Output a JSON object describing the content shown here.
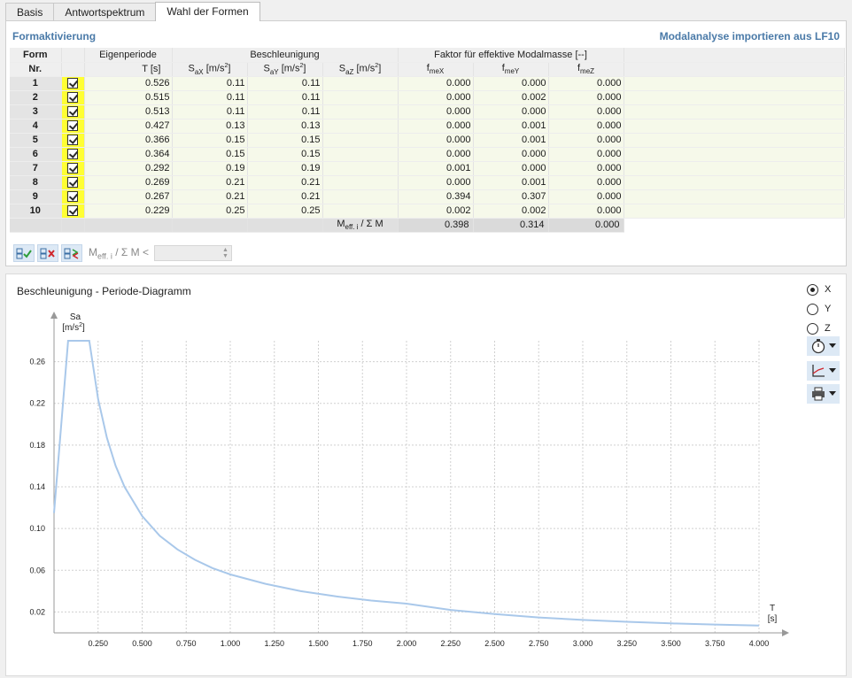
{
  "tabs": [
    {
      "label": "Basis",
      "active": false
    },
    {
      "label": "Antwortspektrum",
      "active": false
    },
    {
      "label": "Wahl der Formen",
      "active": true
    }
  ],
  "section": {
    "title": "Formaktivierung",
    "import_link": "Modalanalyse importieren aus LF10"
  },
  "table": {
    "headers": {
      "form": "Form",
      "nr": "Nr.",
      "eigenperiode": "Eigenperiode",
      "period_unit": "T [s]",
      "beschleunigung": "Beschleunigung",
      "sax": "S",
      "sax_sub": "aX",
      "sa_unit": " [m/s",
      "sup2": "2",
      "close": "]",
      "say_sub": "aY",
      "saz_sub": "aZ",
      "faktor": "Faktor für effektive Modalmasse [--]",
      "f": "f",
      "fmex_sub": "meX",
      "fmey_sub": "meY",
      "fmez_sub": "meZ"
    },
    "rows": [
      {
        "nr": "1",
        "checked": true,
        "t": "0.526",
        "sax": "0.11",
        "say": "0.11",
        "saz": "",
        "fmex": "0.000",
        "fmey": "0.000",
        "fmez": "0.000"
      },
      {
        "nr": "2",
        "checked": true,
        "t": "0.515",
        "sax": "0.11",
        "say": "0.11",
        "saz": "",
        "fmex": "0.000",
        "fmey": "0.002",
        "fmez": "0.000"
      },
      {
        "nr": "3",
        "checked": true,
        "t": "0.513",
        "sax": "0.11",
        "say": "0.11",
        "saz": "",
        "fmex": "0.000",
        "fmey": "0.000",
        "fmez": "0.000"
      },
      {
        "nr": "4",
        "checked": true,
        "t": "0.427",
        "sax": "0.13",
        "say": "0.13",
        "saz": "",
        "fmex": "0.000",
        "fmey": "0.001",
        "fmez": "0.000"
      },
      {
        "nr": "5",
        "checked": true,
        "t": "0.366",
        "sax": "0.15",
        "say": "0.15",
        "saz": "",
        "fmex": "0.000",
        "fmey": "0.001",
        "fmez": "0.000"
      },
      {
        "nr": "6",
        "checked": true,
        "t": "0.364",
        "sax": "0.15",
        "say": "0.15",
        "saz": "",
        "fmex": "0.000",
        "fmey": "0.000",
        "fmez": "0.000"
      },
      {
        "nr": "7",
        "checked": true,
        "t": "0.292",
        "sax": "0.19",
        "say": "0.19",
        "saz": "",
        "fmex": "0.001",
        "fmey": "0.000",
        "fmez": "0.000"
      },
      {
        "nr": "8",
        "checked": true,
        "t": "0.269",
        "sax": "0.21",
        "say": "0.21",
        "saz": "",
        "fmex": "0.000",
        "fmey": "0.001",
        "fmez": "0.000"
      },
      {
        "nr": "9",
        "checked": true,
        "t": "0.267",
        "sax": "0.21",
        "say": "0.21",
        "saz": "",
        "fmex": "0.394",
        "fmey": "0.307",
        "fmez": "0.000"
      },
      {
        "nr": "10",
        "checked": true,
        "t": "0.229",
        "sax": "0.25",
        "say": "0.25",
        "saz": "",
        "fmex": "0.002",
        "fmey": "0.002",
        "fmez": "0.000"
      }
    ],
    "summary": {
      "label_m": "M",
      "label_sub": "eff. i",
      "label_rest": " / Σ M",
      "fmex": "0.398",
      "fmey": "0.314",
      "fmez": "0.000"
    }
  },
  "toolbar": {
    "label_m": "M",
    "label_sub": "eff. i",
    "label_rest": " / Σ M <",
    "threshold_value": ""
  },
  "chart_panel": {
    "title": "Beschleunigung - Periode-Diagramm",
    "radios": [
      {
        "label": "X",
        "selected": true
      },
      {
        "label": "Y",
        "selected": false
      },
      {
        "label": "Z",
        "selected": false
      }
    ]
  },
  "colors": {
    "accent": "#4a7aa8",
    "checkbox_column": "#ffff33",
    "row_fill": "#f6f9ea",
    "curve": "#a9c8ea",
    "button_fill": "#dde9f5"
  },
  "chart_data": {
    "type": "line",
    "title": "",
    "ylabel": "Sa",
    "ylabel_unit": "[m/s",
    "ylabel_sup": "2",
    "ylabel_close": "]",
    "xlabel": "T",
    "xlabel_unit": "[s]",
    "xlim": [
      0,
      4.0
    ],
    "ylim": [
      0,
      0.28
    ],
    "x_ticks": [
      "0.250",
      "0.500",
      "0.750",
      "1.000",
      "1.250",
      "1.500",
      "1.750",
      "2.000",
      "2.250",
      "2.500",
      "2.750",
      "3.000",
      "3.250",
      "3.500",
      "3.750",
      "4.000"
    ],
    "x_tick_values": [
      0.25,
      0.5,
      0.75,
      1.0,
      1.25,
      1.5,
      1.75,
      2.0,
      2.25,
      2.5,
      2.75,
      3.0,
      3.25,
      3.5,
      3.75,
      4.0
    ],
    "y_ticks": [
      "0.02",
      "0.06",
      "0.10",
      "0.14",
      "0.18",
      "0.22",
      "0.26"
    ],
    "y_tick_values": [
      0.02,
      0.06,
      0.1,
      0.14,
      0.18,
      0.22,
      0.26
    ],
    "grid": true,
    "series": [
      {
        "x": [
          0,
          0.08,
          0.2,
          0.25,
          0.3,
          0.35,
          0.4,
          0.5,
          0.6,
          0.7,
          0.8,
          0.9,
          1.0,
          1.2,
          1.4,
          1.6,
          1.8,
          2.0,
          2.25,
          2.5,
          2.75,
          3.0,
          3.25,
          3.5,
          3.75,
          4.0
        ],
        "y": [
          0.115,
          0.28,
          0.28,
          0.224,
          0.187,
          0.16,
          0.14,
          0.112,
          0.093,
          0.08,
          0.07,
          0.062,
          0.056,
          0.047,
          0.04,
          0.035,
          0.031,
          0.028,
          0.022,
          0.018,
          0.0148,
          0.0124,
          0.0106,
          0.0091,
          0.008,
          0.007
        ]
      }
    ]
  }
}
